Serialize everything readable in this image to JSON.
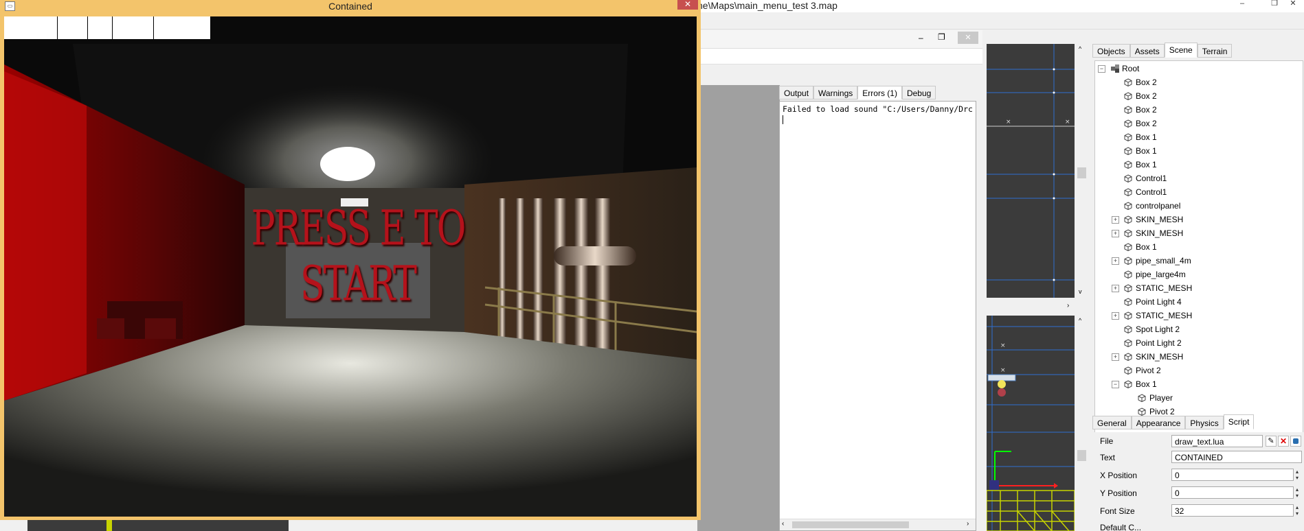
{
  "editor": {
    "title": "ne\\Maps\\main_menu_test 3.map",
    "min_glyph": "–",
    "max_glyph": "❐",
    "close_glyph": "✕"
  },
  "output": {
    "tabs": [
      "Output",
      "Warnings",
      "Errors (1)",
      "Debug"
    ],
    "active_tab": "Errors (1)",
    "line": "Failed to load sound \"C:/Users/Danny/Drc"
  },
  "scene": {
    "tabs": [
      "Objects",
      "Assets",
      "Scene",
      "Terrain"
    ],
    "active_tab": "Scene",
    "items": [
      {
        "label": "Root",
        "level": 0,
        "expander": "−",
        "icon": "root-icon"
      },
      {
        "label": "Box 2",
        "level": 1,
        "expander": "",
        "icon": "box-icon"
      },
      {
        "label": "Box 2",
        "level": 1,
        "expander": "",
        "icon": "box-icon"
      },
      {
        "label": "Box 2",
        "level": 1,
        "expander": "",
        "icon": "box-icon"
      },
      {
        "label": "Box 2",
        "level": 1,
        "expander": "",
        "icon": "box-icon"
      },
      {
        "label": "Box 1",
        "level": 1,
        "expander": "",
        "icon": "box-icon"
      },
      {
        "label": "Box 1",
        "level": 1,
        "expander": "",
        "icon": "box-icon"
      },
      {
        "label": "Box 1",
        "level": 1,
        "expander": "",
        "icon": "box-icon"
      },
      {
        "label": "Control1",
        "level": 1,
        "expander": "",
        "icon": "box-icon"
      },
      {
        "label": "Control1",
        "level": 1,
        "expander": "",
        "icon": "box-icon"
      },
      {
        "label": "controlpanel",
        "level": 1,
        "expander": "",
        "icon": "box-icon"
      },
      {
        "label": "SKIN_MESH",
        "level": 1,
        "expander": "+",
        "icon": "box-icon"
      },
      {
        "label": "SKIN_MESH",
        "level": 1,
        "expander": "+",
        "icon": "box-icon"
      },
      {
        "label": "Box 1",
        "level": 1,
        "expander": "",
        "icon": "box-icon"
      },
      {
        "label": "pipe_small_4m",
        "level": 1,
        "expander": "+",
        "icon": "box-icon"
      },
      {
        "label": "pipe_large4m",
        "level": 1,
        "expander": "",
        "icon": "box-icon"
      },
      {
        "label": "STATIC_MESH",
        "level": 1,
        "expander": "+",
        "icon": "box-icon"
      },
      {
        "label": "Point Light 4",
        "level": 1,
        "expander": "",
        "icon": "box-icon"
      },
      {
        "label": "STATIC_MESH",
        "level": 1,
        "expander": "+",
        "icon": "box-icon"
      },
      {
        "label": "Spot Light 2",
        "level": 1,
        "expander": "",
        "icon": "box-icon"
      },
      {
        "label": "Point Light 2",
        "level": 1,
        "expander": "",
        "icon": "box-icon"
      },
      {
        "label": "SKIN_MESH",
        "level": 1,
        "expander": "+",
        "icon": "box-icon"
      },
      {
        "label": "Pivot 2",
        "level": 1,
        "expander": "",
        "icon": "box-icon"
      },
      {
        "label": "Box 1",
        "level": 1,
        "expander": "−",
        "icon": "box-icon"
      },
      {
        "label": "Player",
        "level": 2,
        "expander": "",
        "icon": "box-icon"
      },
      {
        "label": "Pivot 2",
        "level": 2,
        "expander": "",
        "icon": "box-icon"
      }
    ]
  },
  "properties": {
    "tabs": [
      "General",
      "Appearance",
      "Physics",
      "Script"
    ],
    "active_tab": "Script",
    "file_label": "File",
    "file_value": "draw_text.lua",
    "text_label": "Text",
    "text_value": "CONTAINED",
    "x_label": "X Position",
    "x_value": "0",
    "y_label": "Y Position",
    "y_value": "0",
    "font_label": "Font Size",
    "font_value": "32",
    "partial_label": "Default C..."
  },
  "game": {
    "title": "Contained",
    "close_glyph": "✕",
    "prompt": "PRESS E TO START"
  },
  "colors": {
    "game_frame": "#f3c46b",
    "prompt": "#b5121b",
    "viewport_bg": "#3b3b3b",
    "grid_line": "#3a7bd5",
    "gizmo_yellow": "#c8d400"
  }
}
